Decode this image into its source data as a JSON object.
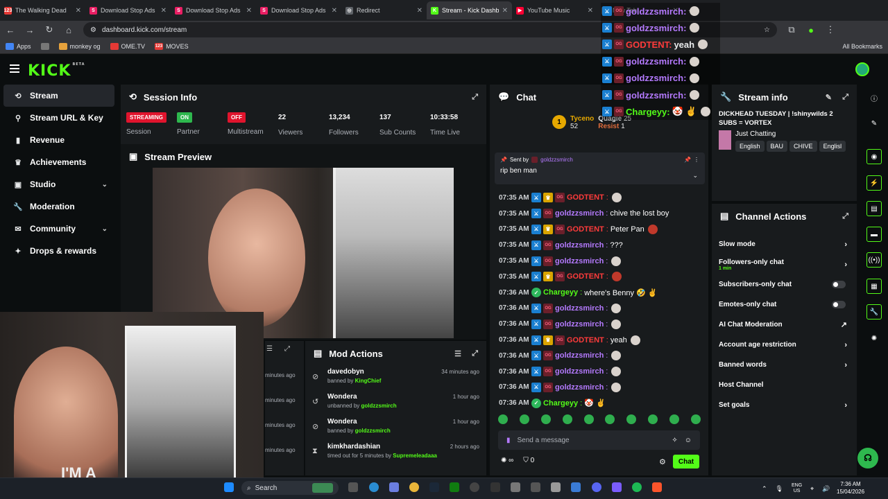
{
  "browser": {
    "tabs": [
      {
        "title": "The Walking Dead",
        "favicon": "123",
        "color": "#e53935"
      },
      {
        "title": "Download Stop Ads",
        "favicon": "S",
        "color": "#e91e63"
      },
      {
        "title": "Download Stop Ads",
        "favicon": "S",
        "color": "#e91e63"
      },
      {
        "title": "Download Stop Ads",
        "favicon": "S",
        "color": "#e91e63"
      },
      {
        "title": "Redirect",
        "favicon": "◎",
        "color": "#5f6368"
      },
      {
        "title": "Stream - Kick Dashb",
        "favicon": "K",
        "color": "#53fc18",
        "active": true
      },
      {
        "title": "YouTube Music",
        "favicon": "▶",
        "color": "#ff0033"
      },
      {
        "title": "New Tab",
        "favicon": "◎",
        "color": "#5f6368"
      }
    ],
    "url": "dashboard.kick.com/stream",
    "bookmarks": [
      {
        "label": "Apps"
      },
      {
        "label": "monkey og"
      },
      {
        "label": "OME.TV"
      },
      {
        "label": "MOVES"
      }
    ],
    "all_bookmarks": "All Bookmarks"
  },
  "app": {
    "logo": "KICK",
    "logo_tag": "BETA"
  },
  "sidebar": {
    "items": [
      {
        "label": "Stream",
        "icon": "stream-icon",
        "active": true
      },
      {
        "label": "Stream URL & Key",
        "icon": "link-icon"
      },
      {
        "label": "Revenue",
        "icon": "revenue-icon"
      },
      {
        "label": "Achievements",
        "icon": "trophy-icon"
      },
      {
        "label": "Studio",
        "icon": "studio-icon",
        "expandable": true
      },
      {
        "label": "Moderation",
        "icon": "wrench-icon"
      },
      {
        "label": "Community",
        "icon": "community-icon",
        "expandable": true
      },
      {
        "label": "Drops & rewards",
        "icon": "gift-icon"
      }
    ]
  },
  "session": {
    "title": "Session Info",
    "cells": [
      {
        "badge": "STREAMING",
        "badge_color": "#e0142d",
        "label": "Session"
      },
      {
        "badge": "ON",
        "badge_color": "#2eb84e",
        "label": "Partner"
      },
      {
        "badge": "OFF",
        "badge_color": "#e0142d",
        "label": "Multistream"
      },
      {
        "value": "22",
        "label": "Viewers"
      },
      {
        "value": "13,234",
        "label": "Followers"
      },
      {
        "value": "137",
        "label": "Sub Counts"
      },
      {
        "value": "10:33:58",
        "label": "Time Live"
      }
    ]
  },
  "preview": {
    "title": "Stream Preview"
  },
  "cam_text": "I'M A",
  "mod_actions": {
    "title": "Mod Actions",
    "items": [
      {
        "user": "davedobyn",
        "action": "banned by",
        "by": "KingChief",
        "time": "34 minutes ago",
        "icon": "ban-icon"
      },
      {
        "user": "Wondera",
        "action": "unbanned by",
        "by": "goldzzsmirch",
        "time": "1 hour ago",
        "icon": "unban-icon"
      },
      {
        "user": "Wondera",
        "action": "banned by",
        "by": "goldzzsmirch",
        "time": "1 hour ago",
        "icon": "ban-icon"
      },
      {
        "user": "kimkhardashian",
        "action": "timed out for 5 minutes by",
        "by": "Supremeleadaaa",
        "time": "2 hours ago",
        "icon": "hourglass-icon"
      }
    ],
    "ghost_times": [
      "minutes ago",
      "minutes ago",
      "minutes ago",
      "minutes ago"
    ]
  },
  "chat": {
    "title": "Chat",
    "top_gifters": [
      {
        "name": "Tyceno",
        "count": "52",
        "rank": "1"
      },
      {
        "name": "Quagie",
        "count": "25"
      },
      {
        "name": "Resist",
        "count": "1"
      }
    ],
    "pinned": {
      "sent_by_label": "Sent by",
      "sent_by": "goldzzsmirch",
      "text": "rip ben man"
    },
    "messages": [
      {
        "time": "07:35 AM",
        "user": "GODTENT",
        "color": "#ff3b3b",
        "badges": [
          "mod",
          "crown",
          "og"
        ],
        "text": "",
        "emote": "skull"
      },
      {
        "time": "07:35 AM",
        "user": "goldzzsmirch",
        "color": "#b57aff",
        "badges": [
          "mod",
          "og"
        ],
        "text": "chive the lost boy"
      },
      {
        "time": "07:35 AM",
        "user": "GODTENT",
        "color": "#ff3b3b",
        "badges": [
          "mod",
          "crown",
          "og"
        ],
        "text": "Peter Pan",
        "emote": "red"
      },
      {
        "time": "07:35 AM",
        "user": "goldzzsmirch",
        "color": "#b57aff",
        "badges": [
          "mod",
          "og"
        ],
        "text": "???"
      },
      {
        "time": "07:35 AM",
        "user": "goldzzsmirch",
        "color": "#b57aff",
        "badges": [
          "mod",
          "og"
        ],
        "text": "",
        "emote": "skull"
      },
      {
        "time": "07:35 AM",
        "user": "GODTENT",
        "color": "#ff3b3b",
        "badges": [
          "mod",
          "crown",
          "og"
        ],
        "text": "",
        "emote": "red"
      },
      {
        "time": "07:36 AM",
        "user": "Chargeyy",
        "color": "#53fc18",
        "badges": [
          "ver"
        ],
        "text": "where's Benny 🤣 ✌"
      },
      {
        "time": "07:36 AM",
        "user": "goldzzsmirch",
        "color": "#b57aff",
        "badges": [
          "mod",
          "og"
        ],
        "text": "",
        "emote": "skull"
      },
      {
        "time": "07:36 AM",
        "user": "goldzzsmirch",
        "color": "#b57aff",
        "badges": [
          "mod",
          "og"
        ],
        "text": "",
        "emote": "skull"
      },
      {
        "time": "07:36 AM",
        "user": "GODTENT",
        "color": "#ff3b3b",
        "badges": [
          "mod",
          "crown",
          "og"
        ],
        "text": "yeah",
        "emote": "skull"
      },
      {
        "time": "07:36 AM",
        "user": "goldzzsmirch",
        "color": "#b57aff",
        "badges": [
          "mod",
          "og"
        ],
        "text": "",
        "emote": "skull"
      },
      {
        "time": "07:36 AM",
        "user": "goldzzsmirch",
        "color": "#b57aff",
        "badges": [
          "mod",
          "og"
        ],
        "text": "",
        "emote": "skull"
      },
      {
        "time": "07:36 AM",
        "user": "goldzzsmirch",
        "color": "#b57aff",
        "badges": [
          "mod",
          "og"
        ],
        "text": "",
        "emote": "skull"
      },
      {
        "time": "07:36 AM",
        "user": "Chargeyy",
        "color": "#53fc18",
        "badges": [
          "ver"
        ],
        "text": "🤡 ✌"
      }
    ],
    "placeholder": "Send a message",
    "send_label": "Chat",
    "footer_count": "0"
  },
  "overlay_chat": [
    {
      "user": "goldzzsmirch:",
      "color": "#b57aff",
      "text": ""
    },
    {
      "user": "goldzzsmirch:",
      "color": "#b57aff",
      "text": ""
    },
    {
      "user": "GODTENT:",
      "color": "#ff3b3b",
      "text": "yeah"
    },
    {
      "user": "goldzzsmirch:",
      "color": "#b57aff",
      "text": ""
    },
    {
      "user": "goldzzsmirch:",
      "color": "#b57aff",
      "text": ""
    },
    {
      "user": "goldzzsmirch:",
      "color": "#b57aff",
      "text": ""
    },
    {
      "user": "Chargeyy:",
      "color": "#53fc18",
      "text": "🤡 ✌"
    }
  ],
  "stream_info": {
    "title": "Stream info",
    "stream_title": "DICKHEAD TUESDAY | !shinywilds 2 SUBS = VORTEX",
    "category": "Just Chatting",
    "tags": [
      "English",
      "BAU",
      "CHIVE",
      "Englisl"
    ]
  },
  "channel_actions": {
    "title": "Channel Actions",
    "items": [
      {
        "label": "Slow mode",
        "control": "chevron"
      },
      {
        "label": "Followers-only chat",
        "sub": "1 min",
        "control": "chevron"
      },
      {
        "label": "Subscribers-only chat",
        "control": "toggle"
      },
      {
        "label": "Emotes-only chat",
        "control": "toggle"
      },
      {
        "label": "AI Chat Moderation",
        "control": "external"
      },
      {
        "label": "Account age restriction",
        "control": "chevron"
      },
      {
        "label": "Banned words",
        "control": "chevron"
      },
      {
        "label": "Host Channel",
        "control": "none"
      },
      {
        "label": "Set goals",
        "control": "chevron"
      }
    ]
  },
  "taskbar": {
    "search": "Search",
    "lang": "ENG",
    "region": "US",
    "time": "7:36 AM",
    "date": "15/04/2026"
  },
  "colors": {
    "accent": "#53fc18",
    "panel": "#181b1d",
    "bg": "#0b0e0f"
  }
}
